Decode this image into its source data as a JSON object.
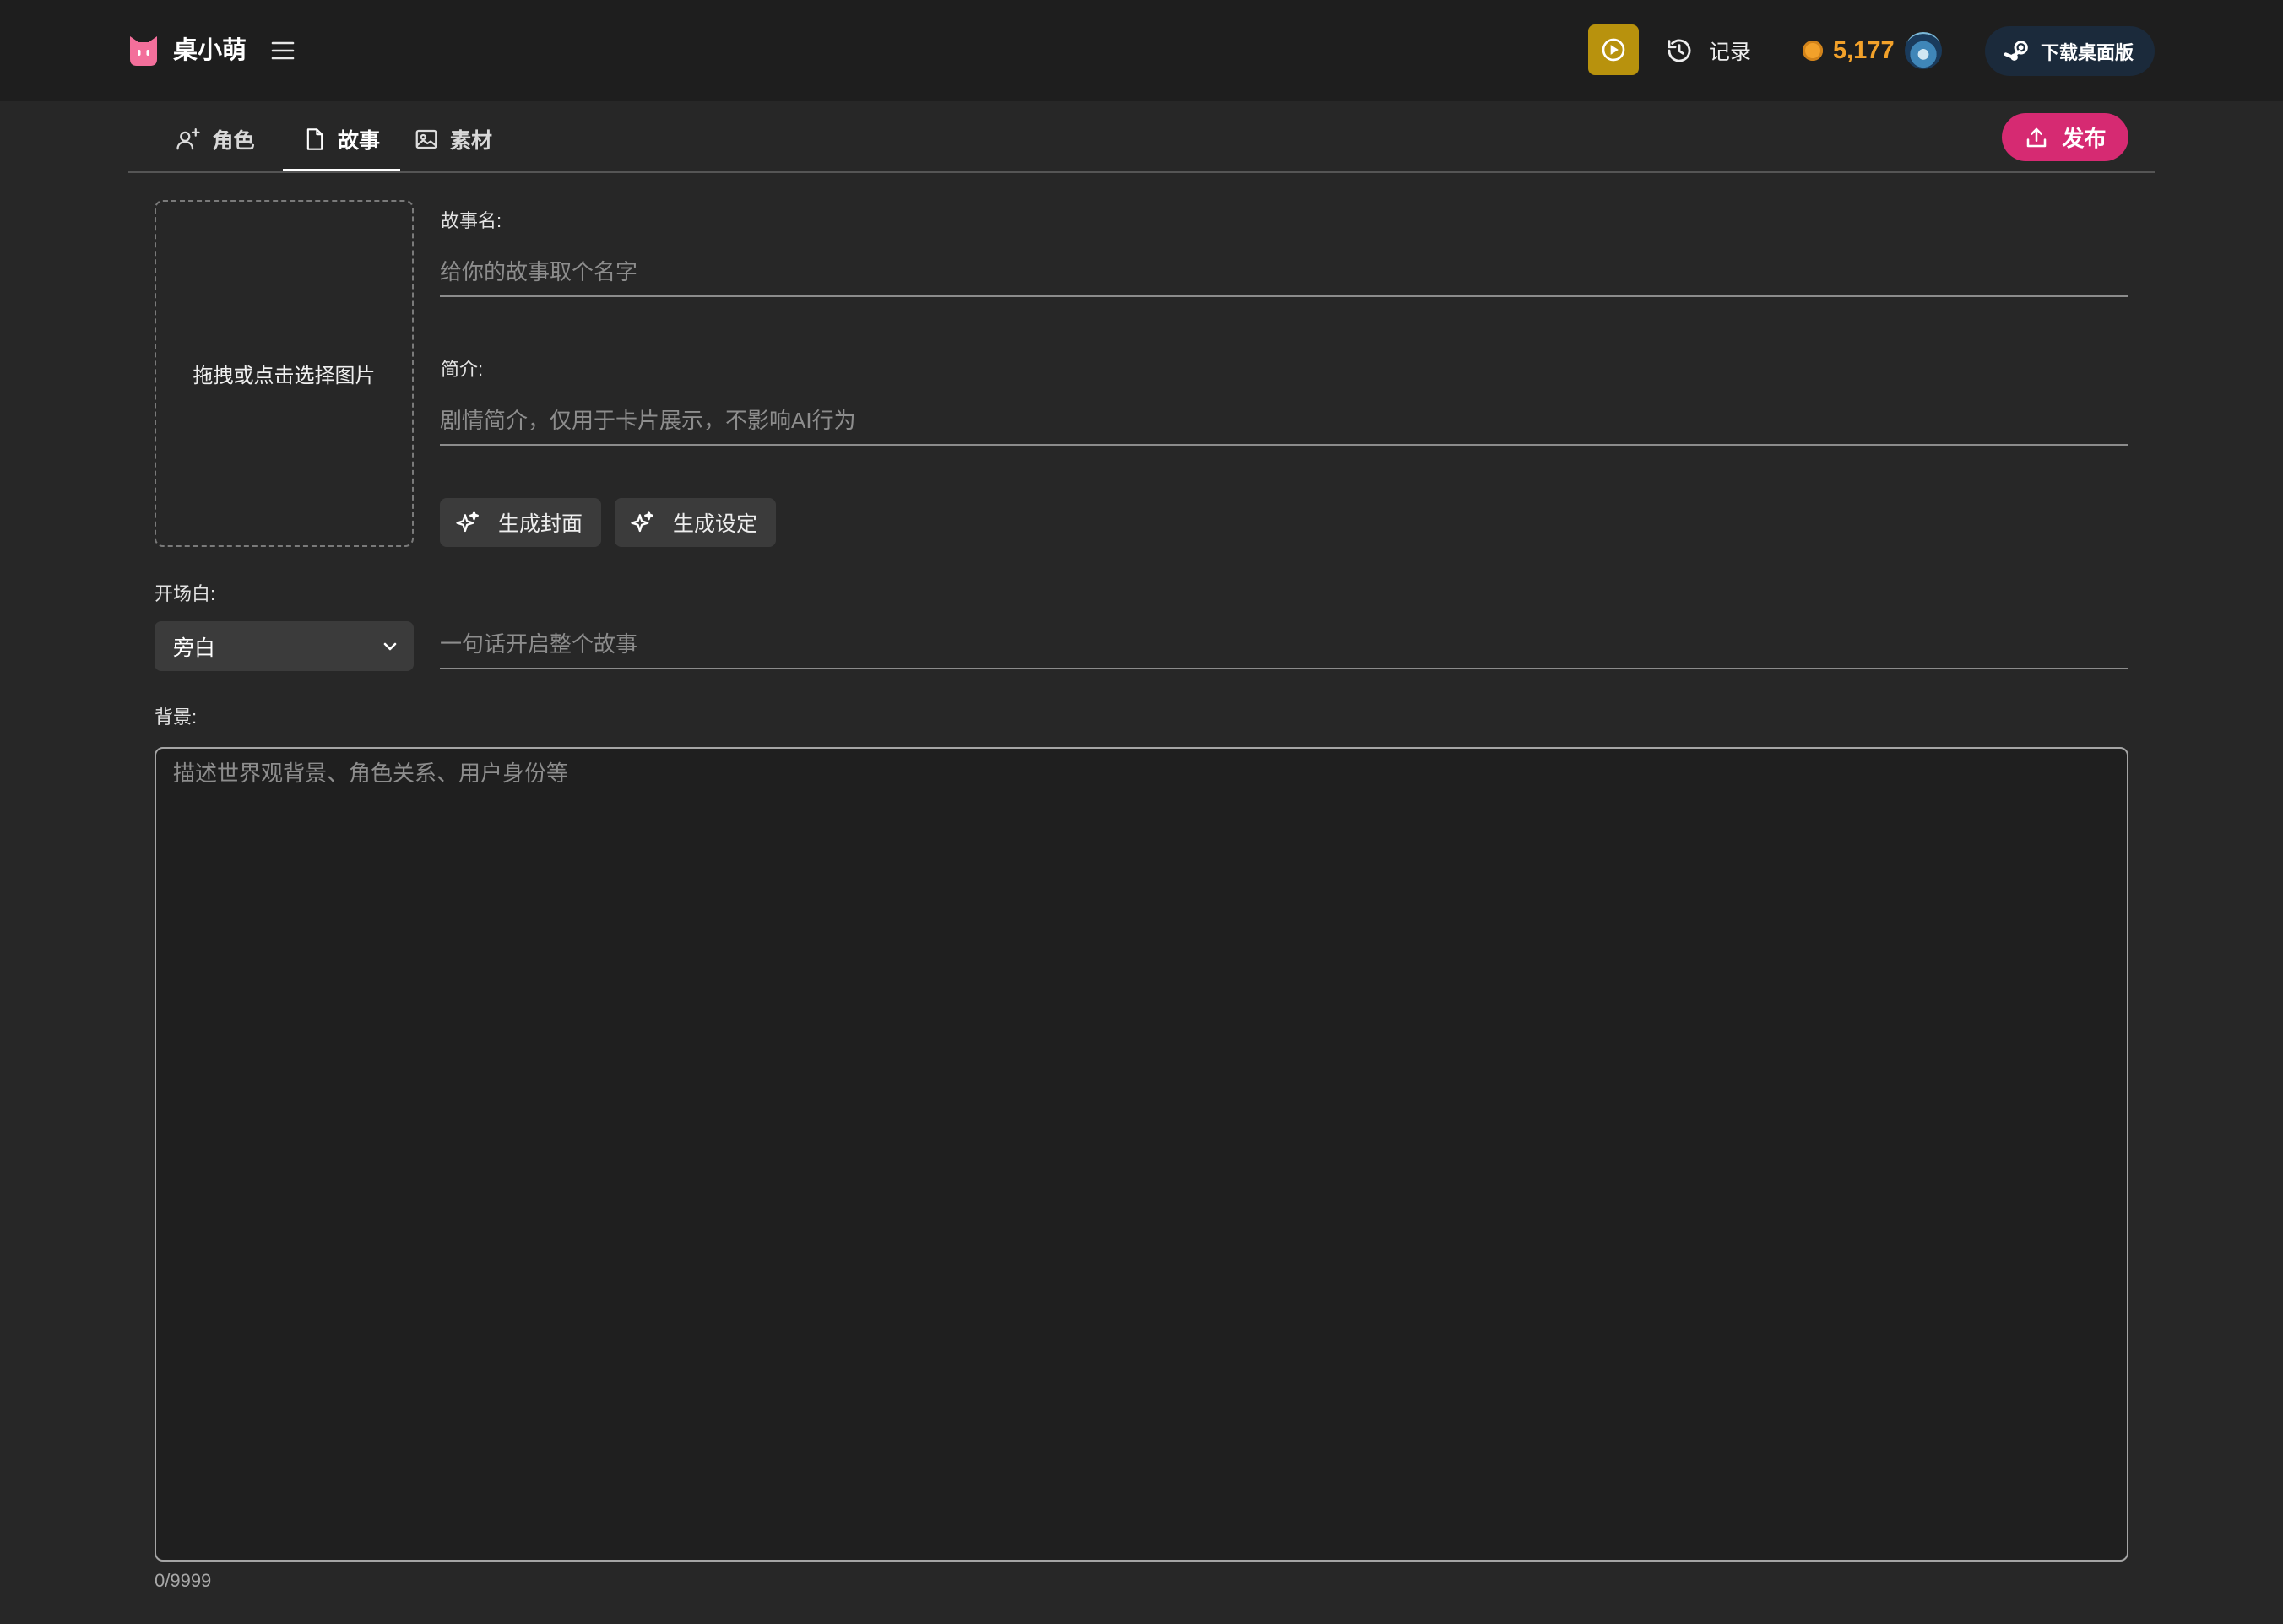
{
  "header": {
    "logo_icon": "pink-cat-logo-icon",
    "brand": "桌小萌",
    "menu_icon": "hamburger-menu-icon",
    "play_icon": "play-circle-icon",
    "history_icon": "history-clock-icon",
    "history_label": "记录",
    "coin_icon": "coin-icon",
    "coins": "5,177",
    "download_icon": "steam-icon",
    "download_label": "下载桌面版"
  },
  "tabs": [
    {
      "label": "角色",
      "icon": "person-add-icon",
      "active": false
    },
    {
      "label": "故事",
      "icon": "document-icon",
      "active": true
    },
    {
      "label": "素材",
      "icon": "image-icon",
      "active": false
    }
  ],
  "publish": {
    "label": "发布",
    "icon": "upload-icon"
  },
  "cover_upload": {
    "label": "拖拽或点击选择图片"
  },
  "story_name": {
    "label": "故事名:",
    "placeholder": "给你的故事取个名字",
    "value": ""
  },
  "intro": {
    "label": "简介:",
    "placeholder": "剧情简介，仅用于卡片展示，不影响AI行为",
    "value": ""
  },
  "generate_buttons": [
    {
      "label": "生成封面",
      "icon": "sparkles-icon"
    },
    {
      "label": "生成设定",
      "icon": "sparkles-icon"
    }
  ],
  "opening": {
    "label": "开场白:",
    "speaker": "旁白",
    "placeholder": "一句话开启整个故事",
    "value": ""
  },
  "background": {
    "label": "背景:",
    "placeholder": "描述世界观背景、角色关系、用户身份等",
    "value": "",
    "counter": "0/9999"
  },
  "colors": {
    "header_bg": "#1e1e1e",
    "page_bg": "#272727",
    "play_button": "#b8920d",
    "coin": "#f2a12a",
    "download_button": "#1b2a3b",
    "publish_button": "#d62a72",
    "active_tab": "#ffffff"
  }
}
